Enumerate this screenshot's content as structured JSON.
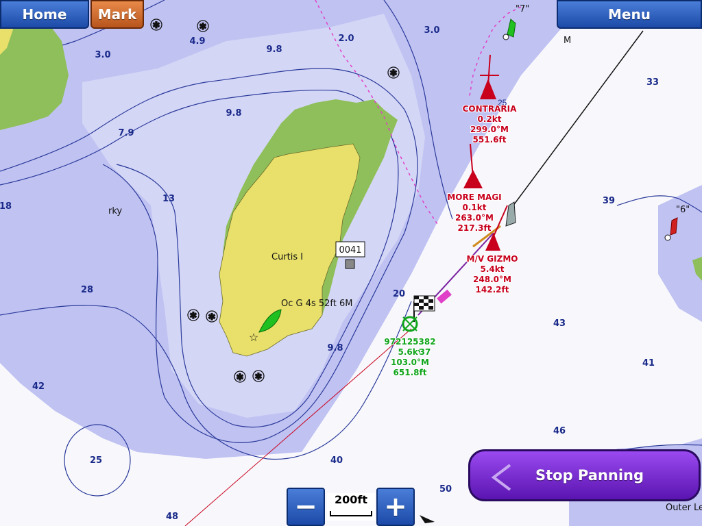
{
  "toolbar": {
    "home_label": "Home",
    "mark_label": "Mark",
    "menu_label": "Menu",
    "stop_panning_label": "Stop Panning",
    "zoom_out_symbol": "−",
    "zoom_in_symbol": "+",
    "scale_label": "200ft"
  },
  "map": {
    "depths": [
      "3.0",
      "4.9",
      "9.8",
      "2.0",
      "3.0",
      "7.9",
      "9.8",
      "33",
      "18",
      "13",
      "39",
      "28",
      "20",
      "43",
      "42",
      "9.8",
      "41",
      "25",
      "40",
      "46",
      "48",
      "50"
    ],
    "land_label": "Curtis I",
    "area_label": "rky",
    "light_label": "Oc G 4s 52ft 6M",
    "waypoint_label": "0041",
    "marker_label": "M",
    "buoy_7_label": "\"7\"",
    "buoy_6_label": "\"6\"",
    "outer_label": "Outer Le",
    "buoy_25_label": "25"
  },
  "targets": [
    {
      "name": "CONTRARIA",
      "speed": "0.2kt",
      "heading": "299.0°M",
      "distance": "551.6ft"
    },
    {
      "name": "MORE MAGI",
      "speed": "0.1kt",
      "heading": "263.0°M",
      "distance": "217.3ft"
    },
    {
      "name": "M/V GIZMO",
      "speed": "5.4kt",
      "heading": "248.0°M",
      "distance": "142.2ft"
    }
  ],
  "own_target": {
    "id": "972125382",
    "speed": "5.6kt",
    "extra": "37",
    "heading": "103.0°M",
    "distance": "651.8ft"
  },
  "colors": {
    "land": "#e8e06a",
    "shore": "#8fbf5a",
    "shallow": "#c0c2f2",
    "deep": "#f8f8fc",
    "contour": "#2a3a9a",
    "target": "#c8001c",
    "own": "#11a51b",
    "accent": "#1c4aa8"
  }
}
